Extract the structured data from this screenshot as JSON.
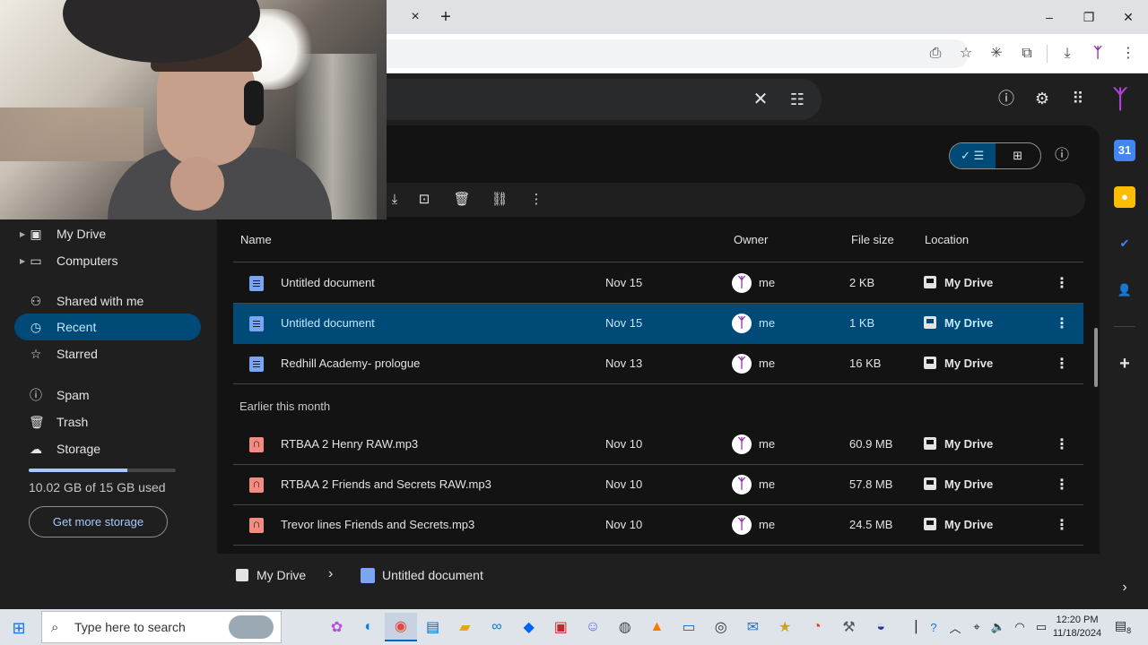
{
  "colors": {
    "accent": "#004a77",
    "accent_text": "#c2e7ff",
    "background": "#131314",
    "surface": "#1f1f1f",
    "doc_icon": "#7aa5f5",
    "audio_icon": "#f28b82",
    "avatar_ribbon": "#8e24aa"
  },
  "browser": {
    "tab_close_icon": "×",
    "new_tab_icon": "+",
    "window_controls": [
      "–",
      "❐",
      "✕"
    ],
    "toolbar_icons": [
      "install-icon",
      "star-icon",
      "extension-pin-icon",
      "extensions-icon",
      "download-icon",
      "profile-ribbon-icon",
      "menu-icon"
    ]
  },
  "drive_header": {
    "search_clear_icon": "✕",
    "search_options_icon": "⚙",
    "icons": [
      "help-icon",
      "settings-icon",
      "apps-icon"
    ]
  },
  "nav": {
    "items": [
      {
        "label": "My Drive",
        "icon": "drive-icon",
        "has_caret": true
      },
      {
        "label": "Computers",
        "icon": "computer-icon",
        "has_caret": true
      },
      {
        "label": "Shared with me",
        "icon": "people-icon"
      },
      {
        "label": "Recent",
        "icon": "clock-icon",
        "active": true
      },
      {
        "label": "Starred",
        "icon": "star-icon"
      },
      {
        "label": "Spam",
        "icon": "spam-icon"
      },
      {
        "label": "Trash",
        "icon": "trash-icon"
      },
      {
        "label": "Storage",
        "icon": "cloud-icon"
      }
    ],
    "storage_used_fraction": 0.668,
    "storage_text": "10.02 GB of 15 GB used",
    "get_more_storage": "Get more storage"
  },
  "main": {
    "columns": {
      "name": "Name",
      "owner": "Owner",
      "file_size": "File size",
      "location": "Location"
    },
    "rows": [
      {
        "name": "Untitled document",
        "type": "doc",
        "date": "Nov 15",
        "owner": "me",
        "size": "2 KB",
        "location": "My Drive"
      },
      {
        "name": "Untitled document",
        "type": "doc",
        "date": "Nov 15",
        "owner": "me",
        "size": "1 KB",
        "location": "My Drive",
        "selected": true
      },
      {
        "name": "Redhill Academy- prologue",
        "type": "doc",
        "date": "Nov 13",
        "owner": "me",
        "size": "16 KB",
        "location": "My Drive"
      }
    ],
    "section_label": "Earlier this month",
    "rows_earlier": [
      {
        "name": "RTBAA 2 Henry RAW.mp3",
        "type": "audio",
        "date": "Nov 10",
        "owner": "me",
        "size": "60.9 MB",
        "location": "My Drive"
      },
      {
        "name": "RTBAA 2 Friends and Secrets RAW.mp3",
        "type": "audio",
        "date": "Nov 10",
        "owner": "me",
        "size": "57.8 MB",
        "location": "My Drive"
      },
      {
        "name": "Trevor lines Friends and Secrets.mp3",
        "type": "audio",
        "date": "Nov 10",
        "owner": "me",
        "size": "24.5 MB",
        "location": "My Drive"
      }
    ],
    "more_icon": "⋮",
    "breadcrumb": {
      "root": "My Drive",
      "separator": "›",
      "current": "Untitled document"
    }
  },
  "taskbar": {
    "search_placeholder": "Type here to search",
    "time": "12:20 PM",
    "date": "11/18/2024",
    "notification_count": "8"
  }
}
